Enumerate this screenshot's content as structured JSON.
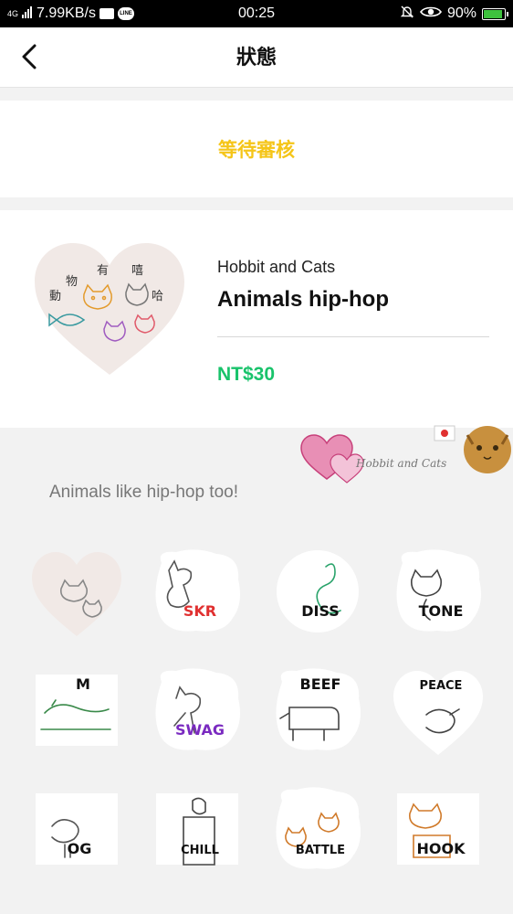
{
  "status_bar": {
    "network": "4G",
    "speed": "7.99KB/s",
    "line_badge": "LINE",
    "time": "00:25",
    "battery": "90%",
    "battery_level": 0.9
  },
  "header": {
    "title": "狀態"
  },
  "status": {
    "text": "等待審核"
  },
  "product": {
    "author": "Hobbit and Cats",
    "name": "Animals hip-hop",
    "price": "NT$30",
    "cover_lettering": "動物有嘻哈"
  },
  "banner": {
    "text": "Hobbit and Cats"
  },
  "description": "Animals like hip-hop too!",
  "stickers": [
    {
      "name": "cover",
      "caption": ""
    },
    {
      "name": "dog-skr",
      "caption": "SKR"
    },
    {
      "name": "snake-diss",
      "caption": "DISS"
    },
    {
      "name": "cat-tone",
      "caption": "TONE"
    },
    {
      "name": "chameleon-m",
      "caption": "M"
    },
    {
      "name": "cat-swag",
      "caption": "SWAG"
    },
    {
      "name": "cow-beef",
      "caption": "BEEF"
    },
    {
      "name": "duck-peace",
      "caption": "PEACE"
    },
    {
      "name": "bird-og",
      "caption": "OG"
    },
    {
      "name": "penguin-chill",
      "caption": "CHILL"
    },
    {
      "name": "cats-battle",
      "caption": "BATTLE"
    },
    {
      "name": "cat-hook",
      "caption": "HOOK"
    }
  ],
  "colors": {
    "status": "#f5c518",
    "price": "#19c36b",
    "heart": "#f1e9e6"
  }
}
